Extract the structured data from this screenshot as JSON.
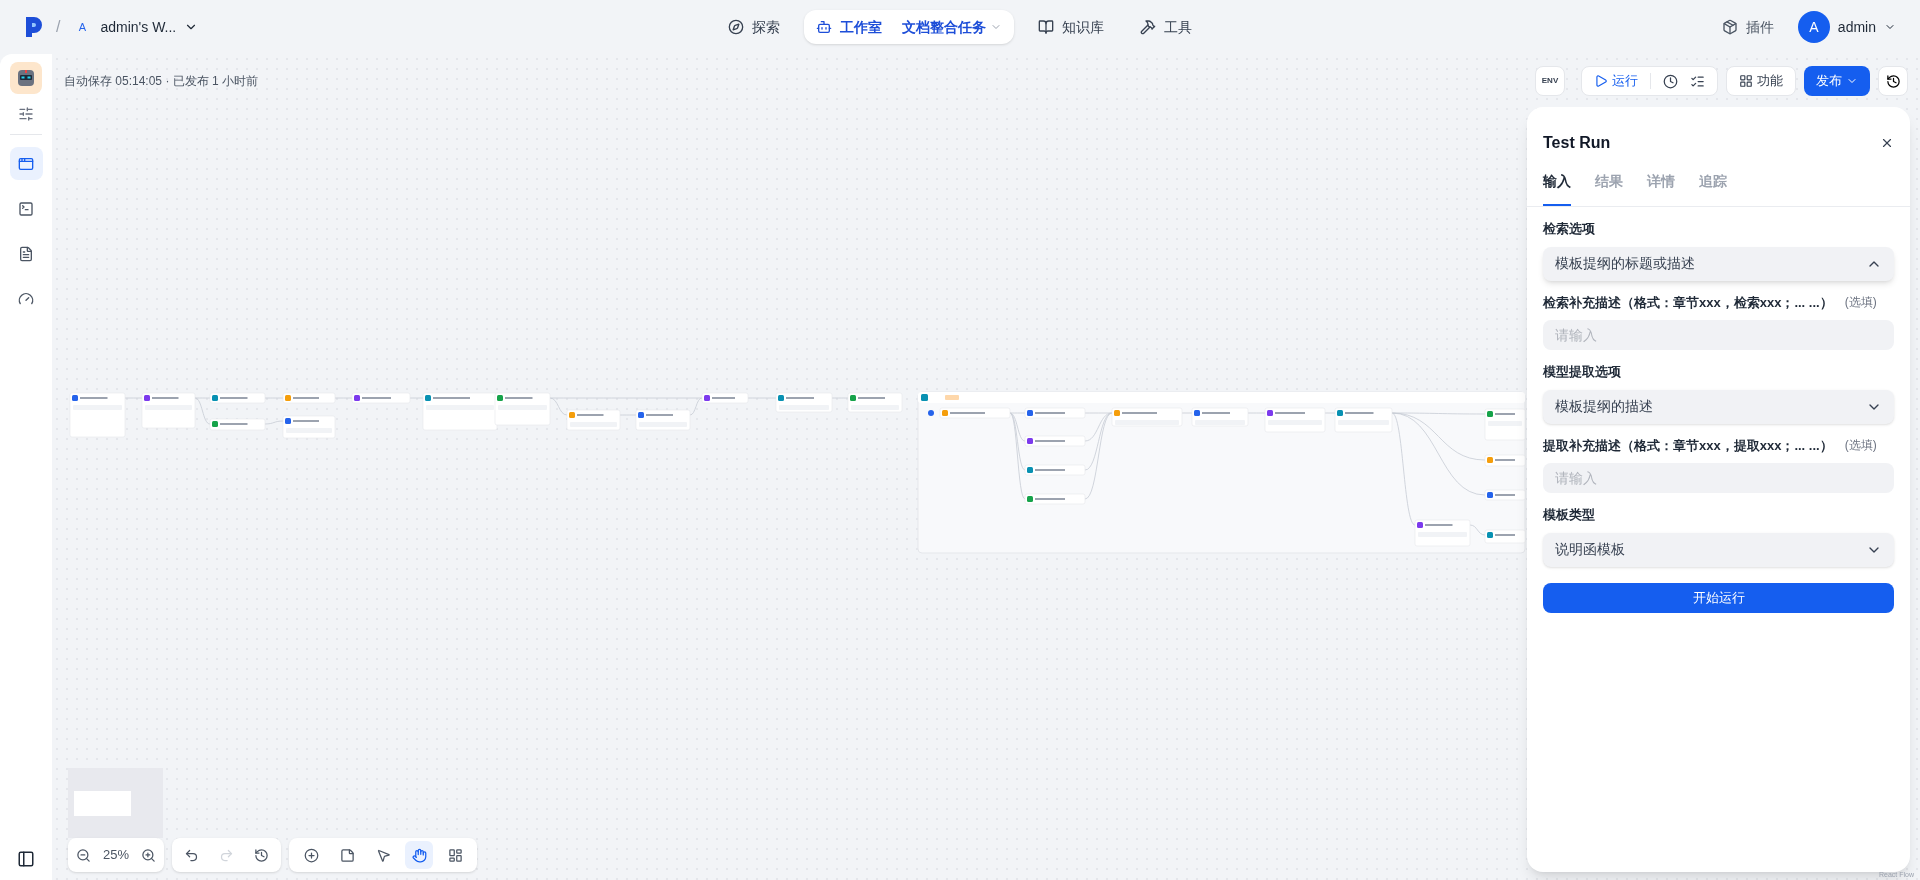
{
  "header": {
    "separator": "/",
    "workspace_initial": "A",
    "workspace": "admin's W...",
    "nav": [
      {
        "kind": "explore",
        "label": "探索",
        "selected": false
      },
      {
        "kind": "studio",
        "label": "工作室",
        "selected": true,
        "sub": "文档整合任务"
      },
      {
        "kind": "knowledge",
        "label": "知识库",
        "selected": false
      },
      {
        "kind": "tools",
        "label": "工具",
        "selected": false
      }
    ],
    "plugins": "插件",
    "user": {
      "initial": "A",
      "name": "admin"
    }
  },
  "sidebar": {
    "items": [
      {
        "kind": "app",
        "selected": true
      },
      {
        "kind": "terminal",
        "selected": false
      },
      {
        "kind": "logs",
        "selected": false
      },
      {
        "kind": "monitor",
        "selected": false
      }
    ]
  },
  "status": "自动保存 05:14:05 · 已发布 1 小时前",
  "toolbar": {
    "env": "ENV",
    "run": "运行",
    "features": "功能",
    "publish": "发布"
  },
  "test_run": {
    "title": "Test Run",
    "tabs": [
      {
        "label": "输入",
        "selected": true
      },
      {
        "label": "结果",
        "selected": false
      },
      {
        "label": "详情",
        "selected": false
      },
      {
        "label": "追踪",
        "selected": false
      }
    ],
    "fields": [
      {
        "kind": "select",
        "label": "检索选项",
        "value": "模板提纲的标题或描述",
        "expanded": true
      },
      {
        "kind": "text",
        "label": "检索补充描述（格式：章节xxx，检索xxx；... ...）",
        "optional": "(选填)",
        "placeholder": "请输入"
      },
      {
        "kind": "select",
        "label": "模型提取选项",
        "value": "模板提纲的描述",
        "expanded": false
      },
      {
        "kind": "text",
        "label": "提取补充描述（格式：章节xxx，提取xxx；... ...）",
        "optional": "(选填)",
        "placeholder": "请输入"
      },
      {
        "kind": "select",
        "label": "模板类型",
        "value": "说明函模板",
        "expanded": false
      }
    ],
    "start": "开始运行"
  },
  "zoom": "25%",
  "history": [
    {
      "kind": "undo",
      "disabled": false
    },
    {
      "kind": "redo",
      "disabled": true
    },
    {
      "kind": "versions",
      "disabled": false
    }
  ],
  "tools": [
    {
      "kind": "add",
      "selected": false
    },
    {
      "kind": "note",
      "selected": false
    },
    {
      "kind": "pointer",
      "selected": false
    },
    {
      "kind": "hand",
      "selected": true
    },
    {
      "kind": "organize",
      "selected": false
    }
  ],
  "attribution": "React Flow"
}
